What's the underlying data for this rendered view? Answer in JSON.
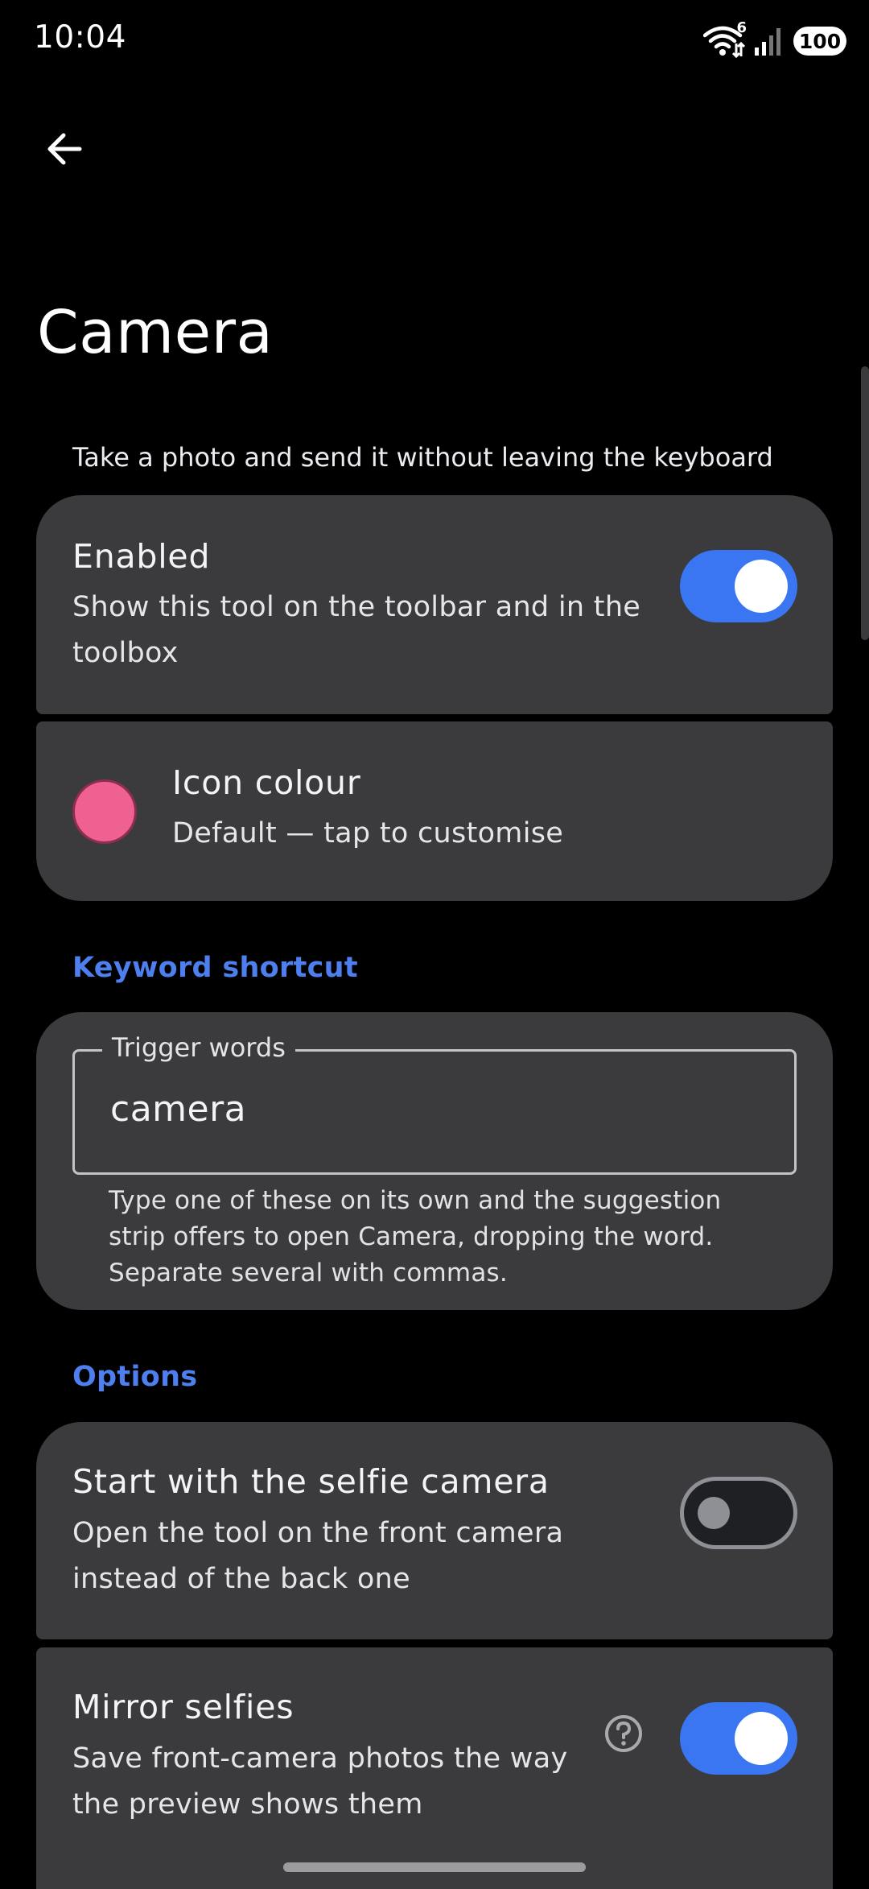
{
  "status_bar": {
    "time": "10:04",
    "wifi_badge": "6",
    "battery": "100",
    "icons": [
      "wifi-icon",
      "signal-icon",
      "battery-icon"
    ]
  },
  "app_bar": {
    "back_icon": "arrow-back-icon"
  },
  "page": {
    "title": "Camera",
    "description": "Take a photo and send it without leaving the keyboard"
  },
  "enabled": {
    "title": "Enabled",
    "subtitle": "Show this tool on the toolbar and in the toolbox",
    "checked": true
  },
  "icon_colour": {
    "title": "Icon colour",
    "subtitle": "Default — tap to customise",
    "color": "#ef6191"
  },
  "keyword_section": {
    "header": "Keyword shortcut",
    "field_label": "Trigger words",
    "field_value": "camera",
    "helper": "Type one of these on its own and the suggestion strip offers to open Camera, dropping the word. Separate several with commas."
  },
  "options_section": {
    "header": "Options"
  },
  "selfie": {
    "title": "Start with the selfie camera",
    "subtitle": "Open the tool on the front camera instead of the back one",
    "checked": false
  },
  "mirror": {
    "title": "Mirror selfies",
    "subtitle": "Save front-camera photos the way the preview shows them",
    "checked": true,
    "help_icon": "help-circle-icon"
  },
  "colors": {
    "background": "#000000",
    "card": "#3b3b3e",
    "accent": "#3b76f2",
    "section_header": "#4d7fee"
  }
}
